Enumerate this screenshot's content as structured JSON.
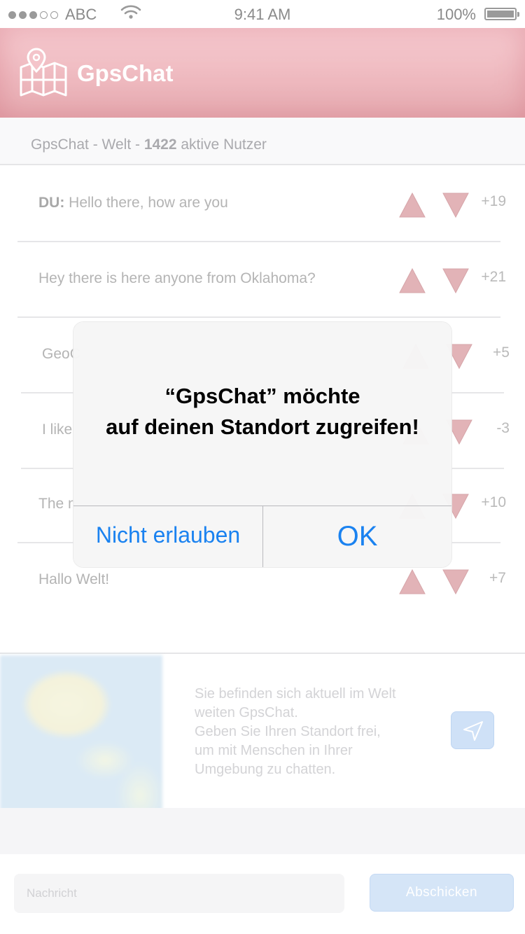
{
  "status_bar": {
    "carrier": "ABC",
    "time": "9:41 AM",
    "battery": "100%"
  },
  "header": {
    "app_name": "GpsChat"
  },
  "subheader": {
    "prefix": "GpsChat - Welt - ",
    "active_count": "1422",
    "suffix": " aktive Nutzer"
  },
  "messages": [
    {
      "author": "DU:",
      "text": " Hello there, how are you",
      "score": "+19"
    },
    {
      "author": "",
      "text": "Hey there is here anyone from Oklahoma?",
      "score": "+21"
    },
    {
      "author": "",
      "text": "GeoC",
      "score": "+5"
    },
    {
      "author": "",
      "text": "I like",
      "score": "-3"
    },
    {
      "author": "",
      "text": "The n",
      "score": "+10"
    },
    {
      "author": "",
      "text": "Hallo Welt!",
      "score": "+7"
    }
  ],
  "info": {
    "line1": "Sie befinden sich aktuell im Welt",
    "line2": "weiten GpsChat.",
    "line3": "Geben Sie Ihren Standort frei,",
    "line4": "um mit Menschen in Ihrer",
    "line5": "Umgebung zu chatten."
  },
  "composer": {
    "placeholder": "Nachricht",
    "send_label": "Abschicken"
  },
  "alert": {
    "title_line1": "“GpsChat” möchte",
    "title_line2": "auf deinen Standort zugreifen!",
    "deny_label": "Nicht erlauben",
    "ok_label": "OK"
  },
  "colors": {
    "header": "#e8a0a8",
    "accent_blue": "#1a82f0",
    "vote_red": "#d99a9f"
  },
  "icons": {
    "logo": "map-pin-icon",
    "vote_up": "triangle-up-icon",
    "vote_down": "triangle-down-icon",
    "locate": "location-arrow-icon"
  }
}
